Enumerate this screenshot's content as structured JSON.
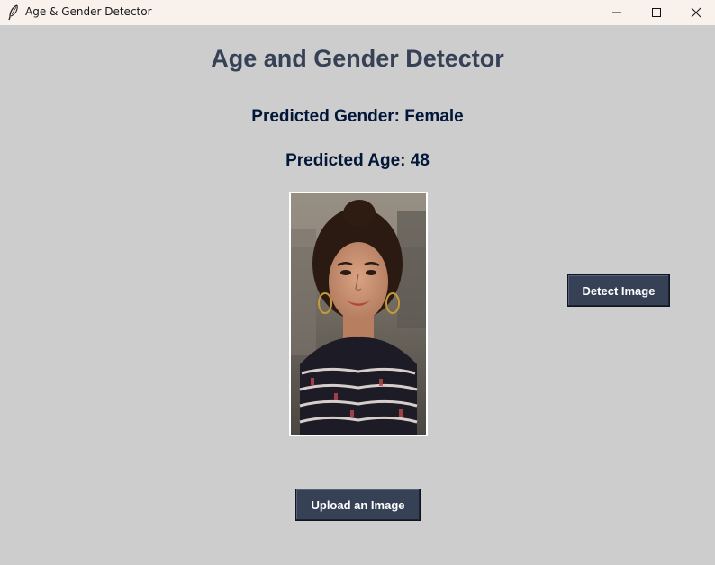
{
  "window": {
    "title": "Age & Gender Detector",
    "icon": "feather-icon",
    "controls": [
      "minimize-icon",
      "maximize-icon",
      "close-icon"
    ]
  },
  "main": {
    "title": "Age and Gender Detector",
    "gender_label": "Predicted Gender: Female",
    "age_label": "Predicted Age: 48",
    "detect_button": "Detect Image",
    "upload_button": "Upload an Image"
  },
  "colors": {
    "background": "#cdcdcd",
    "titlebar": "#f8f1ec",
    "heading": "#364156",
    "result_text": "#011638",
    "button_bg": "#364156",
    "button_text": "#ffffff"
  }
}
